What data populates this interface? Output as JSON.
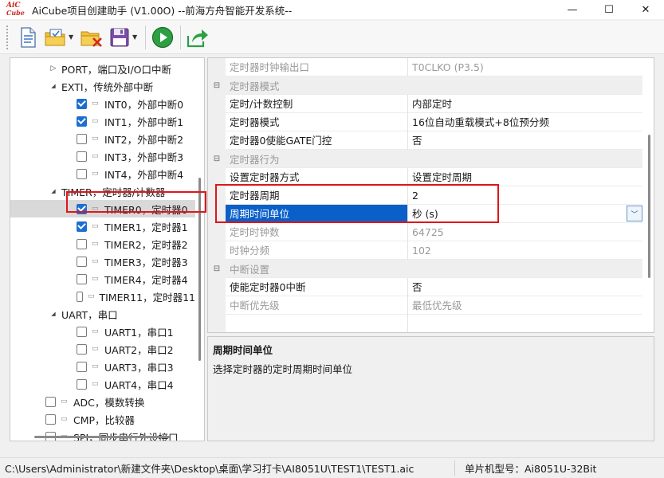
{
  "window": {
    "logo_line1": "AiC",
    "logo_line2": "Cube",
    "title": "AiCube项目创建助手 (V1.00O) --前海方舟智能开发系统--",
    "minimize": "—",
    "maximize": "☐",
    "close": "✕"
  },
  "toolbar": {
    "icons": [
      "new-document-icon",
      "open-folder-icon",
      "close-project-icon",
      "save-icon",
      "run-icon",
      "export-icon"
    ]
  },
  "tree": {
    "items": [
      {
        "label": "PORT，端口及I/O口中断",
        "expand": "▷",
        "checkbox": "none"
      },
      {
        "label": "EXTI，传统外部中断",
        "expand": "◢",
        "checkbox": "none"
      },
      {
        "label": "INT0，外部中断0",
        "checkbox": "checked"
      },
      {
        "label": "INT1，外部中断1",
        "checkbox": "checked"
      },
      {
        "label": "INT2，外部中断2",
        "checkbox": "unchecked"
      },
      {
        "label": "INT3，外部中断3",
        "checkbox": "unchecked"
      },
      {
        "label": "INT4，外部中断4",
        "checkbox": "unchecked"
      },
      {
        "label": "TIMER，定时器/计数器",
        "expand": "◢",
        "checkbox": "none"
      },
      {
        "label": "TIMER0，定时器0",
        "checkbox": "checked",
        "selected": true
      },
      {
        "label": "TIMER1，定时器1",
        "checkbox": "checked"
      },
      {
        "label": "TIMER2，定时器2",
        "checkbox": "unchecked"
      },
      {
        "label": "TIMER3，定时器3",
        "checkbox": "unchecked"
      },
      {
        "label": "TIMER4，定时器4",
        "checkbox": "unchecked"
      },
      {
        "label": "TIMER11，定时器11",
        "checkbox": "unchecked"
      },
      {
        "label": "UART，串口",
        "expand": "◢",
        "checkbox": "none"
      },
      {
        "label": "UART1，串口1",
        "checkbox": "unchecked"
      },
      {
        "label": "UART2，串口2",
        "checkbox": "unchecked"
      },
      {
        "label": "UART3，串口3",
        "checkbox": "unchecked"
      },
      {
        "label": "UART4，串口4",
        "checkbox": "unchecked"
      },
      {
        "label": "ADC，模数转换",
        "checkbox": "unchecked"
      },
      {
        "label": "CMP，比较器",
        "checkbox": "unchecked"
      },
      {
        "label": "SPI，同步串行外设接口",
        "checkbox": "unchecked"
      }
    ]
  },
  "properties": {
    "rows": [
      {
        "name": "定时器时钟输出口",
        "value": "T0CLKO (P3.5)",
        "disabled": true
      },
      {
        "category": "定时器模式"
      },
      {
        "name": "定时/计数控制",
        "value": "内部定时"
      },
      {
        "name": "定时器模式",
        "value": "16位自动重载模式+8位预分频"
      },
      {
        "name": "定时器0使能GATE门控",
        "value": "否"
      },
      {
        "category": "定时器行为"
      },
      {
        "name": "设置定时器方式",
        "value": "设置定时周期"
      },
      {
        "name": "定时器周期",
        "value": "2"
      },
      {
        "name": "周期时间单位",
        "value": "秒 (s)",
        "selected": true
      },
      {
        "name": "定时时钟数",
        "value": "64725",
        "disabled": true
      },
      {
        "name": "时钟分频",
        "value": "102",
        "disabled": true
      },
      {
        "category": "中断设置"
      },
      {
        "name": "使能定时器0中断",
        "value": "否"
      },
      {
        "name": "中断优先级",
        "value": "最低优先级",
        "disabled": true
      }
    ],
    "collapse_glyph": "⊟",
    "combo_arrow": "﹀"
  },
  "description": {
    "title": "周期时间单位",
    "text": "选择定时器的定时周期时间单位"
  },
  "status": {
    "path": "C:\\Users\\Administrator\\新建文件夹\\Desktop\\桌面\\学习打卡\\AI8051U\\TEST1\\TEST1.aic",
    "model": "单片机型号：Ai8051U-32Bit"
  },
  "colors": {
    "selection": "#0a5fc9",
    "checkbox": "#1c6fd1",
    "highlight_box": "#e0151b",
    "run_green": "#2ea043"
  }
}
